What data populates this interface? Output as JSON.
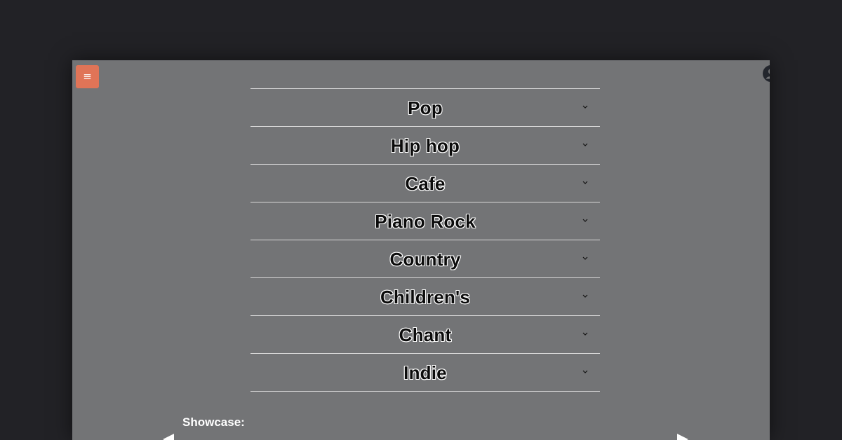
{
  "header": {
    "menu_icon": "hamburger-menu-icon",
    "menu_glyph": "≡",
    "menu_color": "#e07457",
    "user_icon": "user-avatar-icon"
  },
  "genres": [
    {
      "label": "Pop"
    },
    {
      "label": "Hip hop"
    },
    {
      "label": "Cafe"
    },
    {
      "label": "Piano Rock"
    },
    {
      "label": "Country"
    },
    {
      "label": "Children's"
    },
    {
      "label": "Chant"
    },
    {
      "label": "Indie"
    }
  ],
  "genre_expand_icon": "chevron-down-icon",
  "showcase": {
    "label": "Showcase:",
    "prev_icon": "triangle-left-icon",
    "next_icon": "triangle-right-icon"
  },
  "colors": {
    "page_background": "#222226",
    "panel_background": "#737476",
    "divider": "#d9d9d9"
  }
}
